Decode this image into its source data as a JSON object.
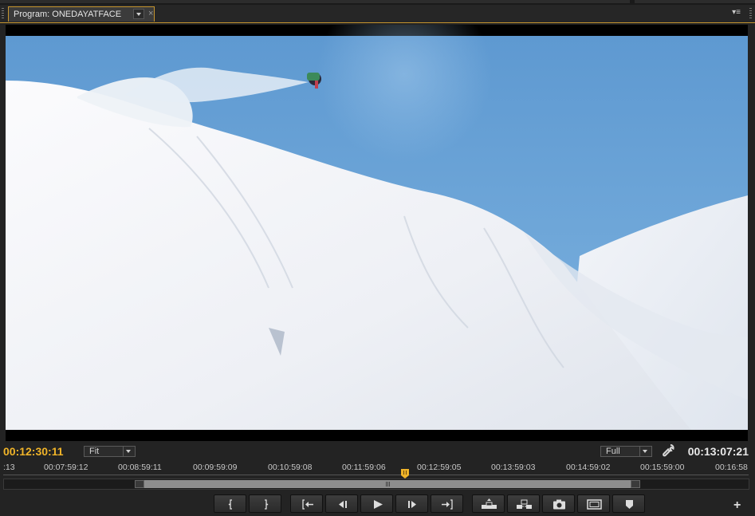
{
  "panel": {
    "tab_title": "Program: ONEDAYATFACE",
    "close_glyph": "×",
    "menu_glyph": "▾≡"
  },
  "viewer": {
    "content": "Snowboarder in mid-air above a snowy slope with blue sky"
  },
  "info_bar": {
    "current_timecode": "00:12:30:11",
    "zoom_select": "Fit",
    "resolution_select": "Full",
    "settings_icon": "wrench-icon",
    "duration_timecode": "00:13:07:21"
  },
  "ruler": {
    "ticks": [
      ":13",
      "00:07:59:12",
      "00:08:59:11",
      "00:09:59:09",
      "00:10:59:08",
      "00:11:59:06",
      "00:12:59:05",
      "00:13:59:03",
      "00:14:59:02",
      "00:15:59:00",
      "00:16:58"
    ]
  },
  "transport": {
    "buttons": [
      {
        "name": "mark-in-button",
        "icon": "mark-in-icon"
      },
      {
        "name": "mark-out-button",
        "icon": "mark-out-icon"
      },
      {
        "name": "go-to-in-button",
        "icon": "go-to-in-icon"
      },
      {
        "name": "step-back-button",
        "icon": "step-back-icon"
      },
      {
        "name": "play-button",
        "icon": "play-icon"
      },
      {
        "name": "step-forward-button",
        "icon": "step-forward-icon"
      },
      {
        "name": "go-to-out-button",
        "icon": "go-to-out-icon"
      },
      {
        "name": "lift-button",
        "icon": "lift-icon"
      },
      {
        "name": "extract-button",
        "icon": "extract-icon"
      },
      {
        "name": "export-frame-button",
        "icon": "camera-icon"
      },
      {
        "name": "safe-margins-button",
        "icon": "safe-margins-icon"
      },
      {
        "name": "add-marker-button",
        "icon": "marker-icon"
      }
    ],
    "add_glyph": "+"
  },
  "colors": {
    "accent": "#c5952f",
    "timecode": "#f0b429",
    "background": "#232323"
  }
}
